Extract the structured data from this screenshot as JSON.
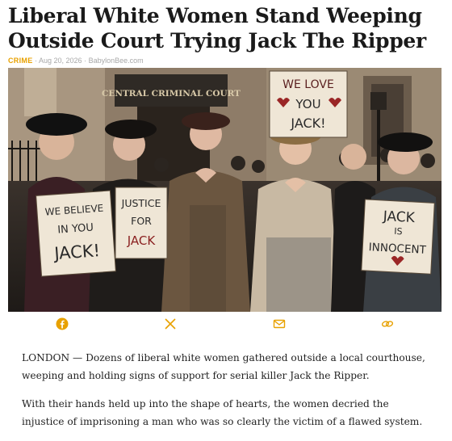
{
  "article": {
    "headline": "Liberal White Women Stand Weeping Outside Court Trying Jack The Ripper",
    "category": "CRIME",
    "date": "Aug 20, 2026",
    "author": "BabylonBee.com",
    "meta_separator": " · "
  },
  "photo": {
    "building_sign": "CENTRAL CRIMINAL COURT",
    "signs": {
      "top": [
        "WE LOVE",
        "YOU",
        "JACK!"
      ],
      "left": [
        "WE BELIEVE",
        "IN YOU",
        "JACK!"
      ],
      "center": [
        "JUSTICE",
        "FOR",
        "JACK"
      ],
      "right": [
        "JACK",
        "IS",
        "INNOCENT"
      ]
    }
  },
  "share": {
    "icons": [
      "facebook-icon",
      "x-icon",
      "email-icon",
      "link-icon"
    ],
    "accent": "#e8a100"
  },
  "body": {
    "paragraphs": [
      "LONDON — Dozens of liberal white women gathered outside a local courthouse, weeping and holding signs of support for serial killer Jack the Ripper.",
      "With their hands held up into the shape of hearts, the women decried the injustice of imprisoning a man who was so clearly the victim of a flawed system."
    ]
  }
}
